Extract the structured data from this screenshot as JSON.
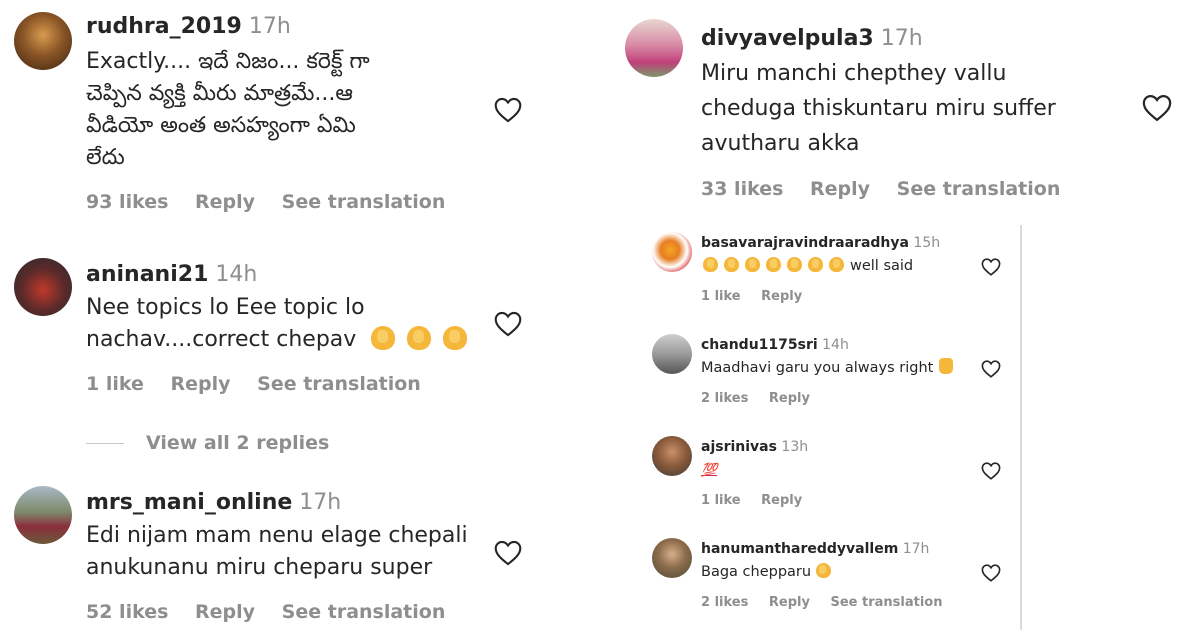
{
  "left_comments": [
    {
      "username": "rudhra_2019",
      "time": "17h",
      "text_lines": [
        "Exactly.... ఇదే నిజం... కరెక్ట్ గా",
        "చెప్పిన వ్యక్తి మీరు మాత్రమే...ఆ",
        "వీడియో అంత అసహ్యంగా ఏమి",
        "లేదు"
      ],
      "likes": "93 likes",
      "reply": "Reply",
      "translate": "See translation"
    },
    {
      "username": "aninani21",
      "time": "14h",
      "text_lines": [
        "Nee topics lo Eee topic lo",
        "nachav....correct chepav"
      ],
      "likes": "1 like",
      "reply": "Reply",
      "translate": "See translation"
    },
    {
      "username": "mrs_mani_online",
      "time": "17h",
      "text_lines": [
        "Edi nijam mam nenu elage chepali",
        "anukunanu miru cheparu super"
      ],
      "likes": "52 likes",
      "reply": "Reply",
      "translate": "See translation"
    }
  ],
  "view_replies": "View all 2 replies",
  "right_comment": {
    "username": "divyavelpula3",
    "time": "17h",
    "text_lines": [
      "Miru manchi chepthey vallu",
      "cheduga thiskuntaru miru suffer",
      "avutharu akka"
    ],
    "likes": "33 likes",
    "reply": "Reply",
    "translate": "See translation"
  },
  "replies": [
    {
      "username": "basavarajravindraaradhya",
      "time": "15h",
      "text": "well said",
      "likes": "1 like",
      "reply": "Reply"
    },
    {
      "username": "chandu1175sri",
      "time": "14h",
      "text": "Maadhavi garu you always right",
      "likes": "2 likes",
      "reply": "Reply"
    },
    {
      "username": "ajsrinivas",
      "time": "13h",
      "text": "",
      "likes": "1 like",
      "reply": "Reply"
    },
    {
      "username": "hanumanthareddyvallem",
      "time": "17h",
      "text": "Baga chepparu",
      "likes": "2 likes",
      "reply": "Reply",
      "translate": "See translation"
    }
  ],
  "emoji": {
    "clap": "clapping-hands-icon",
    "thumb": "thumbs-up-icon",
    "hundred": "💯"
  },
  "colors": {
    "text": "#262626",
    "muted": "#8e8e8e",
    "background": "#ffffff"
  }
}
